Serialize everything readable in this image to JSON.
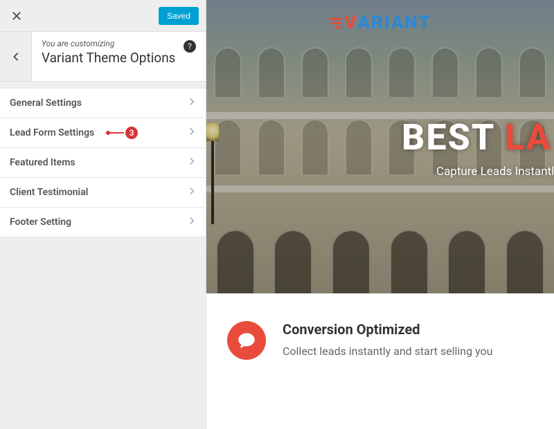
{
  "topbar": {
    "saved_label": "Saved"
  },
  "header": {
    "customizing_label": "You are customizing",
    "panel_title": "Variant Theme Options",
    "help_glyph": "?"
  },
  "menu": {
    "items": [
      {
        "label": "General Settings"
      },
      {
        "label": "Lead Form Settings"
      },
      {
        "label": "Featured Items"
      },
      {
        "label": "Client Testimonial"
      },
      {
        "label": "Footer Setting"
      }
    ]
  },
  "annotation": {
    "number": "3",
    "on_index": 1
  },
  "preview": {
    "logo": {
      "v": "V",
      "rest": "ARIANT"
    },
    "hero_title_a": "BEST ",
    "hero_title_b": "LA",
    "hero_subtitle": "Capture Leads Instantly a",
    "feature": {
      "title": "Conversion Optimized",
      "desc": "Collect leads instantly and start selling you"
    }
  }
}
